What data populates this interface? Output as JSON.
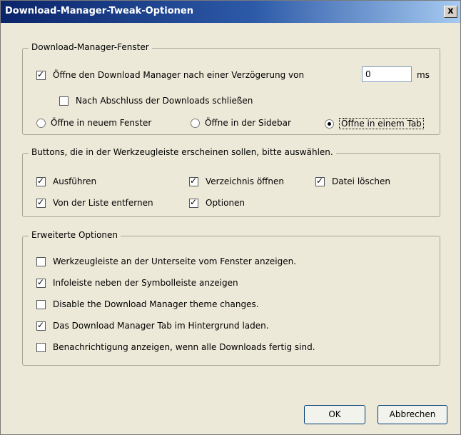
{
  "window": {
    "title": "Download-Manager-Tweak-Optionen",
    "close_label": "x"
  },
  "group1": {
    "legend": "Download-Manager-Fenster",
    "delay_checkbox": {
      "label": "Öffne den Download Manager nach einer Verzögerung von",
      "checked": true
    },
    "delay_value": "0",
    "delay_unit": "ms",
    "close_after_checkbox": {
      "label": "Nach Abschluss der Downloads schließen",
      "checked": false
    },
    "radios": [
      {
        "label": "Öffne in neuem Fenster",
        "checked": false
      },
      {
        "label": "Öffne in der Sidebar",
        "checked": false
      },
      {
        "label": "Öffne in einem Tab",
        "checked": true
      }
    ]
  },
  "group2": {
    "legend": "Buttons, die in der Werkzeugleiste erscheinen sollen, bitte auswählen.",
    "checkboxes": [
      {
        "label": "Ausführen",
        "checked": true
      },
      {
        "label": "Verzeichnis öffnen",
        "checked": true
      },
      {
        "label": "Datei löschen",
        "checked": true
      },
      {
        "label": "Von der Liste entfernen",
        "checked": true
      },
      {
        "label": "Optionen",
        "checked": true
      }
    ]
  },
  "group3": {
    "legend": "Erweiterte Optionen",
    "checkboxes": [
      {
        "label": "Werkzeugleiste an der Unterseite vom Fenster anzeigen.",
        "checked": false
      },
      {
        "label": "Infoleiste neben der Symbolleiste anzeigen",
        "checked": true
      },
      {
        "label": "Disable the Download Manager theme changes.",
        "checked": false
      },
      {
        "label": "Das Download Manager Tab im Hintergrund laden.",
        "checked": true
      },
      {
        "label": "Benachrichtigung anzeigen, wenn alle Downloads fertig sind.",
        "checked": false
      }
    ]
  },
  "buttons": {
    "ok_label": "OK",
    "cancel_label": "Abbrechen"
  }
}
